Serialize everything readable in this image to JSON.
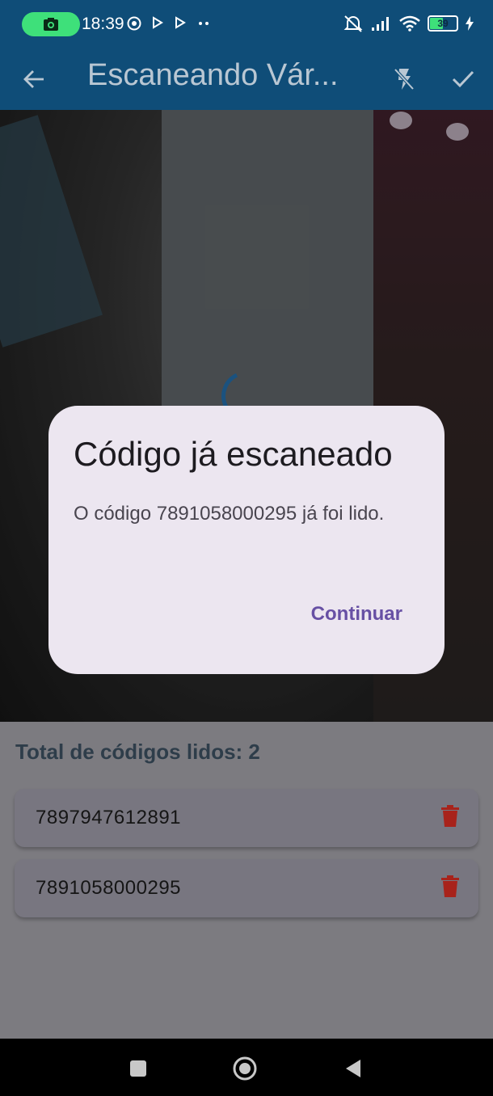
{
  "status_bar": {
    "time": "18:39",
    "battery": "39"
  },
  "app_bar": {
    "title": "Escaneando Vár..."
  },
  "list": {
    "total_label": "Total de códigos lidos: 2",
    "items": [
      {
        "code": "7897947612891"
      },
      {
        "code": "7891058000295"
      }
    ]
  },
  "dialog": {
    "title": "Código já escaneado",
    "message": "O código 7891058000295 já foi lido.",
    "button": "Continuar"
  },
  "colors": {
    "app_bar": "#0f4d78",
    "dialog_bg": "#ece6f0",
    "accent": "#6750a4",
    "delete": "#a8231b"
  },
  "icons": {
    "back": "arrow-left-icon",
    "flash": "flash-off-icon",
    "confirm": "check-icon",
    "delete": "trash-icon"
  }
}
